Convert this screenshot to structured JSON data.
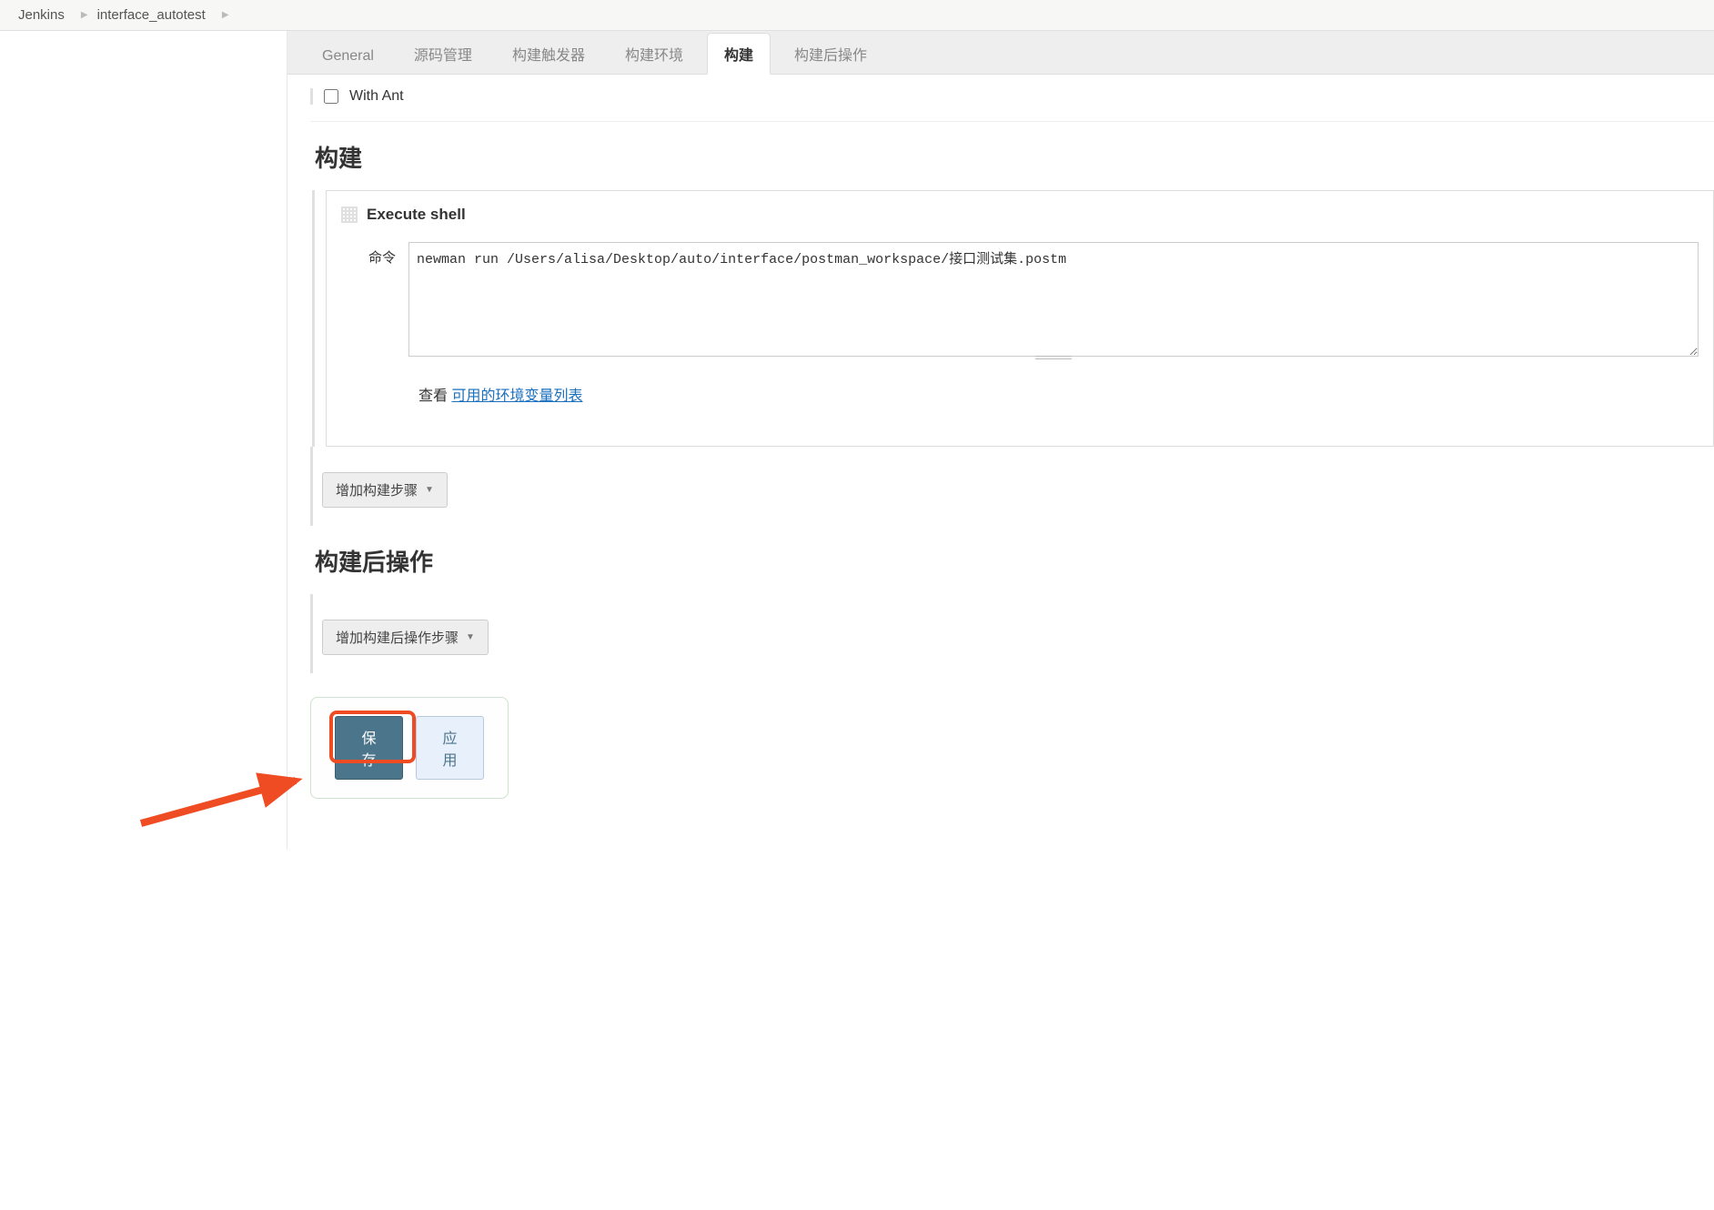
{
  "breadcrumb": {
    "root": "Jenkins",
    "project": "interface_autotest"
  },
  "tabs": {
    "general": "General",
    "scm": "源码管理",
    "triggers": "构建触发器",
    "env": "构建环境",
    "build": "构建",
    "postbuild": "构建后操作"
  },
  "env_section": {
    "with_ant_label": "With Ant"
  },
  "build_section": {
    "title": "构建",
    "step_title": "Execute shell",
    "command_label": "命令",
    "command_value": "newman run /Users/alisa/Desktop/auto/interface/postman_workspace/接口测试集.postm",
    "see_text": "查看 ",
    "env_vars_link": "可用的环境变量列表",
    "add_step_label": "增加构建步骤"
  },
  "postbuild_section": {
    "title": "构建后操作",
    "add_step_label": "增加构建后操作步骤"
  },
  "buttons": {
    "save": "保存",
    "apply": "应用"
  }
}
